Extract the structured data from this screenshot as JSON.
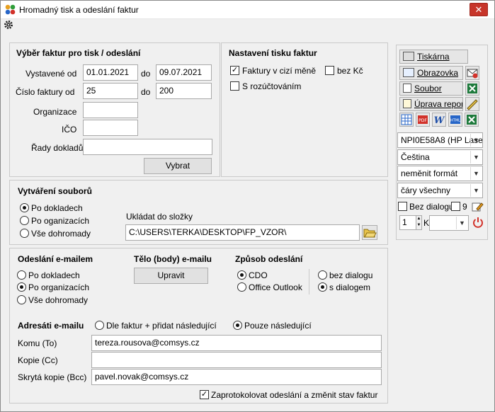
{
  "window": {
    "title": "Hromadný tisk a odeslání faktur",
    "close": "✕"
  },
  "selection": {
    "title": "Výběr faktur pro tisk / odeslání",
    "issued_from_label": "Vystavené od",
    "issued_from": "01.01.2021",
    "to_label": "do",
    "issued_to": "09.07.2021",
    "number_from_label": "Číslo faktury od",
    "number_from": "25",
    "number_to": "200",
    "organization_label": "Organizace",
    "organization": "",
    "ico_label": "IČO",
    "ico": "",
    "series_label": "Řady dokladů",
    "series": "",
    "select_button": "Vybrat"
  },
  "print_settings": {
    "title": "Nastavení tisku faktur",
    "foreign_currency": "Faktury v cizí měně",
    "without_kc": "bez Kč",
    "with_breakdown": "S rozúčtováním"
  },
  "files": {
    "title": "Vytváření souborů",
    "opt_documents": "Po dokladech",
    "opt_organizations": "Po oganizacích",
    "opt_all": "Vše dohromady",
    "folder_label": "Ukládat do složky",
    "folder_path": "C:\\USERS\\TERKA\\DESKTOP\\FP_VZOR\\"
  },
  "email": {
    "title": "Odeslání e-mailem",
    "opt_documents": "Po dokladech",
    "opt_organizations": "Po organizacích",
    "opt_all": "Vše dohromady",
    "body_title": "Tělo (body) e-mailu",
    "edit_button": "Upravit",
    "method_title": "Způsob odeslání",
    "cdo": "CDO",
    "outlook": "Office Outlook",
    "no_dialog": "bez dialogu",
    "with_dialog": "s dialogem",
    "recipients_title": "Adresáti e-mailu",
    "by_invoices": "Dle faktur + přidat následující",
    "only_following": "Pouze následující",
    "to_label": "Komu (To)",
    "to": "tereza.rousova@comsys.cz",
    "cc_label": "Kopie (Cc)",
    "cc": "",
    "bcc_label": "Skrytá kopie (Bcc)",
    "bcc": "pavel.novak@comsys.cz",
    "log_label": "Zaprotokolovat odeslání a změnit stav faktur"
  },
  "output_panel": {
    "printer": "Tiskárna",
    "screen": "Obrazovka",
    "file": "Soubor",
    "edit_report": "Úprava report",
    "printer_select": "NPI0E58A8 (HP Lase",
    "language_select": "Čeština",
    "format_select": "neměnit formát",
    "lines_select": "čáry všechny",
    "no_dialog": "Bez dialogu",
    "nine": "9",
    "copies": "1",
    "k_label": "K",
    "k_select": ""
  }
}
